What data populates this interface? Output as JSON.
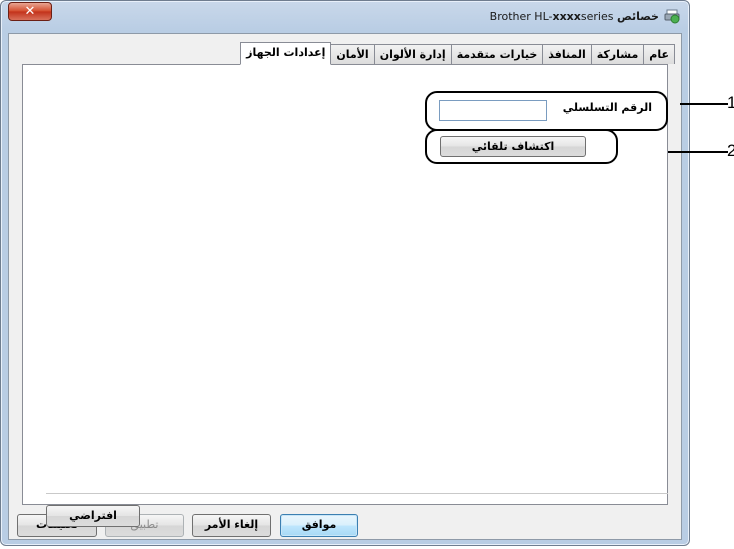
{
  "window": {
    "title_prefix": "Brother HL-",
    "title_model": "xxxx",
    "title_suffix": "series",
    "title_rtl": "خصائص",
    "close_label": "✕"
  },
  "tabs": [
    {
      "label": "عام",
      "active": false
    },
    {
      "label": "مشاركة",
      "active": false
    },
    {
      "label": "المنافذ",
      "active": false
    },
    {
      "label": "خيارات متقدمة",
      "active": false
    },
    {
      "label": "إدارة الألوان",
      "active": false
    },
    {
      "label": "الأمان",
      "active": false
    },
    {
      "label": "إعدادات الجهاز",
      "active": true
    }
  ],
  "device_settings": {
    "serial_label": "الرقم التسلسلي",
    "serial_value": "",
    "auto_detect_label": "اكتشاف تلقائي",
    "default_label": "افتراضي"
  },
  "footer": {
    "ok_label": "موافق",
    "cancel_label": "إلغاء الأمر",
    "apply_label": "تطبيق",
    "help_label": "تعليمات"
  },
  "callouts": {
    "one": "1",
    "two": "2"
  }
}
